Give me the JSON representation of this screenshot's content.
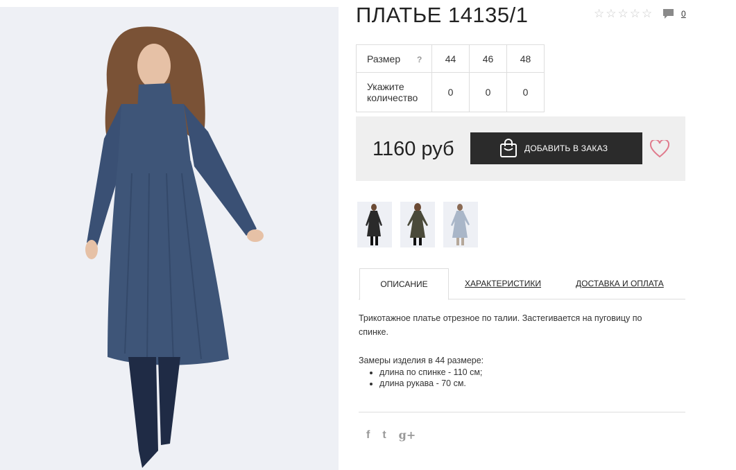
{
  "product": {
    "title": "ПЛАТЬЕ 14135/1",
    "rating_stars": 5,
    "comments_count": "0"
  },
  "sizes": {
    "size_label": "Размер",
    "help_label": "?",
    "quantity_label": "Укажите количество",
    "items": [
      {
        "size": "44",
        "qty": "0"
      },
      {
        "size": "46",
        "qty": "0"
      },
      {
        "size": "48",
        "qty": "0"
      }
    ]
  },
  "buy": {
    "price": "1160 руб",
    "add_to_cart_label": "ДОБАВИТЬ В ЗАКАЗ"
  },
  "thumbnails": [
    {
      "color": "#2a2a2a"
    },
    {
      "color": "#4a4a3a"
    },
    {
      "color": "#a9b6c8"
    }
  ],
  "tabs": [
    {
      "label": "ОПИСАНИЕ"
    },
    {
      "label": "ХАРАКТЕРИСТИКИ"
    },
    {
      "label": "ДОСТАВКА И ОПЛАТА"
    }
  ],
  "description": {
    "text": "Трикотажное платье отрезное по талии. Застегивается на пуговицу по спинке.",
    "measures_title": "Замеры изделия в 44 размере:",
    "measures": [
      "длина по спинке - 110 см;",
      "длина рукава - 70 см."
    ]
  },
  "social": {
    "facebook": "f",
    "twitter": "t",
    "google": "g+"
  },
  "colors": {
    "dress": "#3e5578",
    "button_bg": "#2b2b2b",
    "heart": "#e07a8c"
  }
}
